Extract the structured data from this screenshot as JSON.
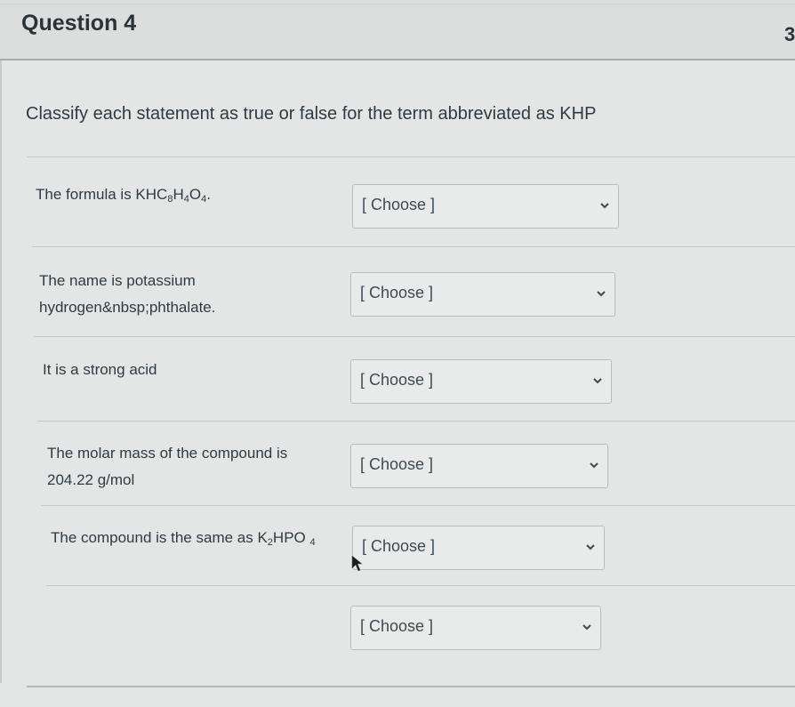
{
  "header": {
    "title": "Question 4",
    "points": "3"
  },
  "prompt": "Classify each statement as true or false for the term abbreviated as KHP",
  "statements": [
    {
      "text_prefix": "The formula is KHC",
      "sub1": "8",
      "mid1": "H",
      "sub2": "4",
      "mid2": "O",
      "sub3": "4",
      "suffix": "."
    },
    {
      "line1": "The name is potassium",
      "line2": "hydrogen&nbsp;phthalate."
    },
    {
      "text": "It is a strong acid"
    },
    {
      "line1": "The molar mass of the compound is",
      "line2": "204.22 g/mol"
    },
    {
      "text_prefix": "The compound is the same as K",
      "sub1": "2",
      "mid1": "HPO ",
      "sub2": "4"
    }
  ],
  "selects": [
    {
      "value": "[ Choose ]",
      "icon": "chevron-down-icon"
    },
    {
      "value": "[ Choose ]",
      "icon": "chevron-down-icon"
    },
    {
      "value": "[ Choose ]",
      "icon": "chevron-down-icon"
    },
    {
      "value": "[ Choose ]",
      "icon": "chevron-down-icon"
    },
    {
      "value": "[ Choose ]",
      "icon": "chevron-down-icon"
    },
    {
      "value": "[ Choose ]",
      "icon": "chevron-down-icon"
    }
  ]
}
